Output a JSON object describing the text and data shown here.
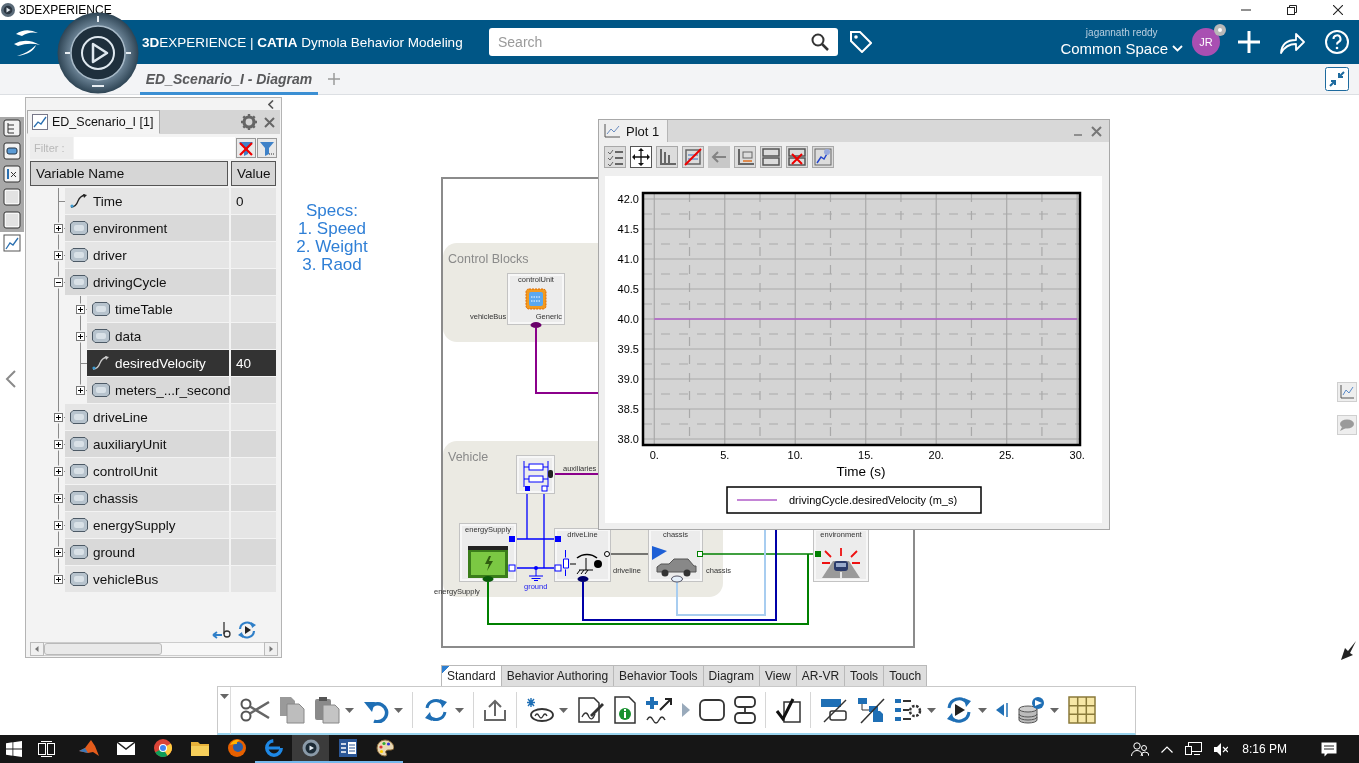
{
  "title_bar": {
    "title": "3DEXPERIENCE"
  },
  "header": {
    "brand": "**3D**EXPERIENCE | **CATIA** Dymola Behavior Modeling",
    "search": {
      "placeholder": "Search"
    },
    "user_name": "jagannath reddy",
    "space": "Common Space",
    "avatar": "JR"
  },
  "tabs": [
    {
      "label": "ED_Scenario_I - Diagram",
      "selected": true
    }
  ],
  "side_tools": [
    {
      "selected": false
    },
    {
      "selected": false
    },
    {
      "selected": false
    },
    {
      "selected": false
    },
    {
      "selected": false
    },
    {
      "selected": true
    }
  ],
  "variable_panel": {
    "tab": {
      "label": "ED_Scenario_I [1]",
      "selected": true
    },
    "filter_label": "Filter :",
    "columns": [
      "Variable Name",
      "Value"
    ],
    "rows": [
      {
        "name": "Time",
        "kind": "variable",
        "value": "0",
        "selected": false
      },
      {
        "name": "environment",
        "kind": "class",
        "expanded": false,
        "selected": false
      },
      {
        "name": "driver",
        "kind": "class",
        "expanded": false,
        "selected": false
      },
      {
        "name": "drivingCycle",
        "kind": "class",
        "expanded": true,
        "selected": false,
        "children": [
          {
            "name": "timeTable",
            "kind": "class",
            "expanded": false,
            "selected": false
          },
          {
            "name": "data",
            "kind": "class",
            "expanded": false,
            "selected": false
          },
          {
            "name": "desiredVelocity",
            "kind": "variable",
            "value": "40",
            "selected": true
          },
          {
            "name": "meters_...r_second",
            "kind": "class",
            "expanded": false,
            "selected": false
          }
        ]
      },
      {
        "name": "driveLine",
        "kind": "class",
        "expanded": false,
        "selected": false
      },
      {
        "name": "auxiliaryUnit",
        "kind": "class",
        "expanded": false,
        "selected": false
      },
      {
        "name": "controlUnit",
        "kind": "class",
        "expanded": false,
        "selected": false
      },
      {
        "name": "chassis",
        "kind": "class",
        "expanded": false,
        "selected": false
      },
      {
        "name": "energySupply",
        "kind": "class",
        "expanded": false,
        "selected": false
      },
      {
        "name": "ground",
        "kind": "class",
        "expanded": false,
        "selected": false
      },
      {
        "name": "vehicleBus",
        "kind": "class",
        "expanded": false,
        "selected": false
      }
    ]
  },
  "specs_note": "Specs:\n1. Speed\n2. Weight\n3. Raod",
  "diagram": {
    "groups": [
      {
        "label": "Control Blocks"
      },
      {
        "label": "Vehicle"
      }
    ],
    "blocks": [
      {
        "kind": "control_unit",
        "name": "controlUnit",
        "caption": "Generic",
        "port_label": "vehicleBus"
      },
      {
        "kind": "auxiliary",
        "port_label": "auxiliaries"
      },
      {
        "kind": "battery",
        "name": "energySupply",
        "port_label": "energySupply"
      },
      {
        "kind": "ground",
        "name": "ground"
      },
      {
        "kind": "drive_line",
        "name": "driveLine",
        "port_label": "driveline"
      },
      {
        "kind": "chassis",
        "name": "chassis",
        "port_label": "chassis"
      },
      {
        "kind": "environment",
        "name": "environment"
      }
    ]
  },
  "plot_window": {
    "title": "Plot 1",
    "tools": [
      {
        "selected": false,
        "disabled": false
      },
      {
        "selected": true,
        "disabled": false
      },
      {
        "selected": false,
        "disabled": false
      },
      {
        "selected": false,
        "disabled": false
      },
      {
        "selected": false,
        "disabled": true
      },
      {
        "selected": false,
        "disabled": false
      },
      {
        "selected": false,
        "disabled": false
      },
      {
        "selected": false,
        "disabled": false
      },
      {
        "selected": false,
        "disabled": false
      }
    ],
    "chart_data": {
      "type": "line",
      "xlabel": "Time (s)",
      "x": [
        0,
        30
      ],
      "series": [
        {
          "name": "drivingCycle.desiredVelocity (m_s)",
          "color": "#b05cc8",
          "values": [
            40,
            40
          ]
        }
      ],
      "xlim": [
        -0.8,
        30.2
      ],
      "ylim": [
        37.9,
        42.1
      ],
      "xticks": [
        {
          "value": 0,
          "label": "0."
        },
        {
          "value": 5,
          "label": "5."
        },
        {
          "value": 10,
          "label": "10."
        },
        {
          "value": 15,
          "label": "15."
        },
        {
          "value": 20,
          "label": "20."
        },
        {
          "value": 25,
          "label": "25."
        },
        {
          "value": 30,
          "label": "30."
        }
      ],
      "yticks": [
        {
          "value": 38,
          "label": "38.0"
        },
        {
          "value": 38.5,
          "label": "38.5"
        },
        {
          "value": 39,
          "label": "39.0"
        },
        {
          "value": 39.5,
          "label": "39.5"
        },
        {
          "value": 40,
          "label": "40.0"
        },
        {
          "value": 40.5,
          "label": "40.5"
        },
        {
          "value": 41,
          "label": "41.0"
        },
        {
          "value": 41.5,
          "label": "41.5"
        },
        {
          "value": 42,
          "label": "42.0"
        }
      ],
      "grid": true
    }
  },
  "toolbar_tabs": [
    {
      "label": "Standard",
      "selected": true
    },
    {
      "label": "Behavior Authoring",
      "selected": false
    },
    {
      "label": "Behavior Tools",
      "selected": false
    },
    {
      "label": "Diagram",
      "selected": false
    },
    {
      "label": "View",
      "selected": false
    },
    {
      "label": "AR-VR",
      "selected": false
    },
    {
      "label": "Tools",
      "selected": false
    },
    {
      "label": "Touch",
      "selected": false
    }
  ],
  "taskbar": {
    "apps": [
      {
        "selected": false,
        "running": false
      },
      {
        "selected": false,
        "running": false
      },
      {
        "selected": false,
        "running": false
      },
      {
        "selected": false,
        "running": false
      },
      {
        "selected": false,
        "running": false
      },
      {
        "selected": false,
        "running": true
      },
      {
        "selected": true,
        "running": true
      },
      {
        "selected": false,
        "running": true
      },
      {
        "selected": false,
        "running": true
      }
    ],
    "clock": "8:16 PM"
  }
}
